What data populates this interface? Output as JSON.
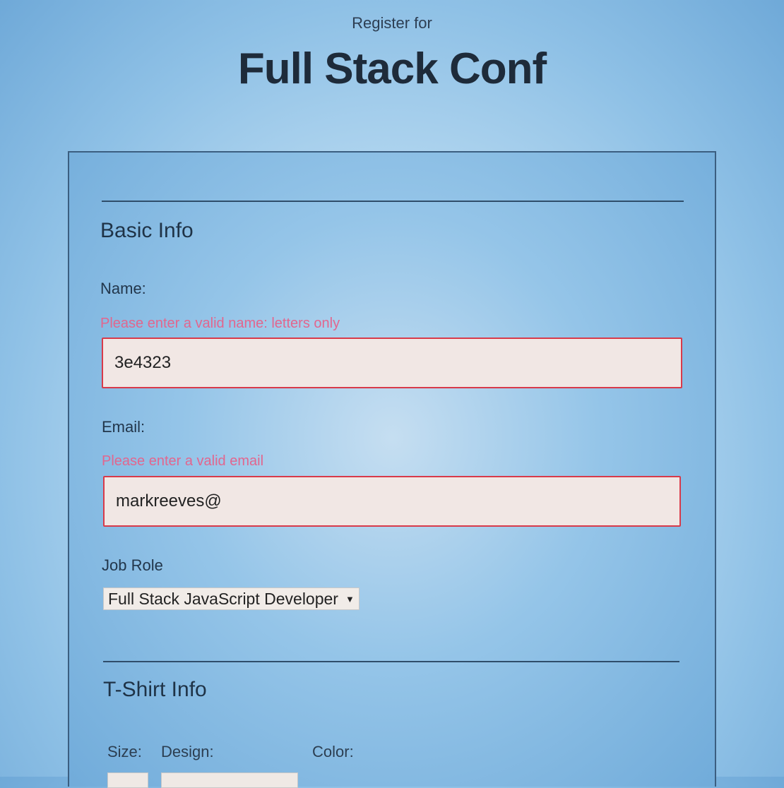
{
  "header": {
    "pre_title": "Register for",
    "title": "Full Stack Conf"
  },
  "basic_info": {
    "heading": "Basic Info",
    "name": {
      "label": "Name:",
      "error": "Please enter a valid name: letters only",
      "value": "3e4323"
    },
    "email": {
      "label": "Email:",
      "error": "Please enter a valid email",
      "value": "markreeves@"
    },
    "job_role": {
      "label": "Job Role",
      "selected": "Full Stack JavaScript Developer"
    }
  },
  "tshirt_info": {
    "heading": "T-Shirt Info",
    "size_label": "Size:",
    "design_label": "Design:",
    "color_label": "Color:"
  },
  "colors": {
    "error_text": "#e2668e",
    "error_border": "#d83a4a",
    "field_bg": "#f1e7e4"
  },
  "icons": {
    "select_caret": "caret-down-icon"
  }
}
